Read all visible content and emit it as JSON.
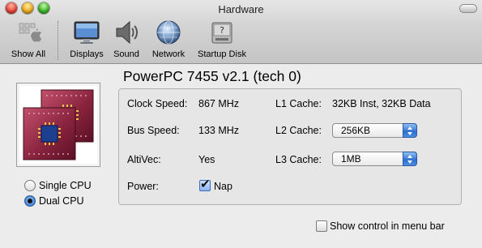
{
  "window": {
    "title": "Hardware"
  },
  "toolbar": {
    "items": [
      {
        "label": "Show All",
        "icon": "apple-prefs-icon"
      },
      {
        "label": "Displays",
        "icon": "display-icon"
      },
      {
        "label": "Sound",
        "icon": "speaker-icon"
      },
      {
        "label": "Network",
        "icon": "globe-icon"
      },
      {
        "label": "Startup Disk",
        "icon": "hard-disk-icon"
      }
    ]
  },
  "cpu": {
    "processor_title": "PowerPC 7455 v2.1 (tech 0)",
    "radio_single": "Single CPU",
    "radio_dual": "Dual CPU",
    "selected_mode": "Dual CPU"
  },
  "info": {
    "clock_label": "Clock Speed:",
    "clock_value": "867 MHz",
    "bus_label": "Bus Speed:",
    "bus_value": "133 MHz",
    "altivec_label": "AltiVec:",
    "altivec_value": "Yes",
    "power_label": "Power:",
    "nap_label": "Nap",
    "nap_checked": true,
    "l1_label": "L1 Cache:",
    "l1_value": "32KB Inst, 32KB Data",
    "l2_label": "L2 Cache:",
    "l2_value": "256KB",
    "l3_label": "L3 Cache:",
    "l3_value": "1MB"
  },
  "footer": {
    "menu_bar_label": "Show control in menu bar",
    "menu_bar_checked": false
  },
  "colors": {
    "accent": "#2c6fd0",
    "chip": "#7a1f36"
  }
}
